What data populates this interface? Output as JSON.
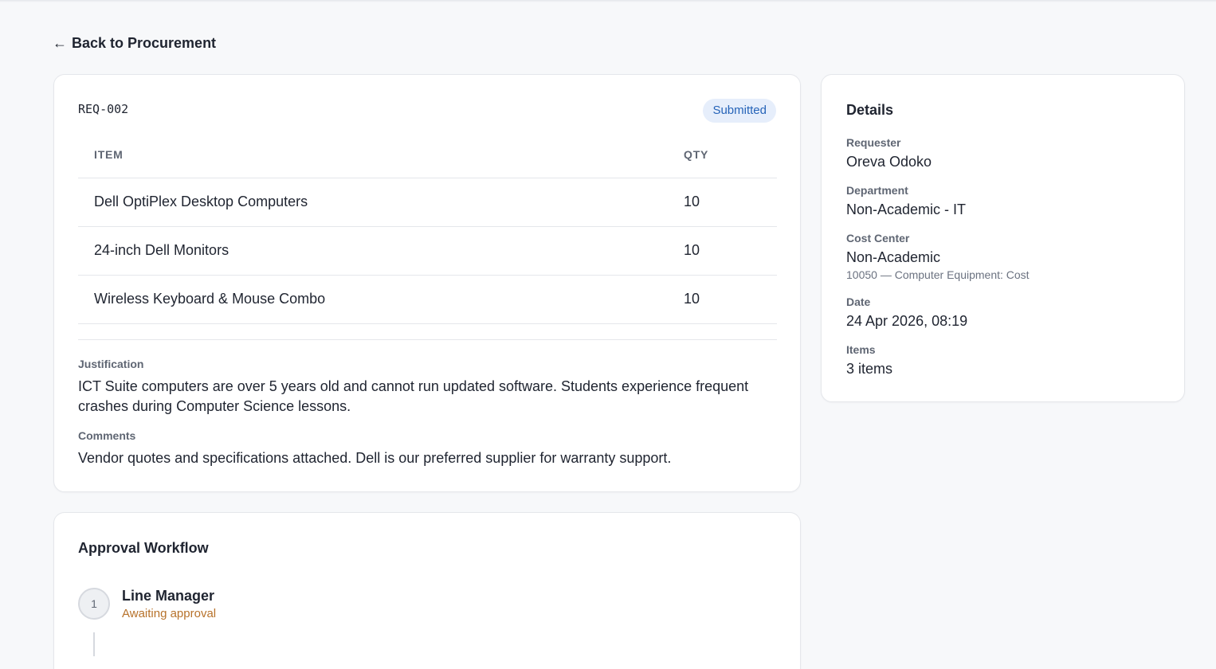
{
  "nav": {
    "back_arrow": "←",
    "back_label": "Back to Procurement"
  },
  "request": {
    "id": "REQ-002",
    "status": "Submitted",
    "table": {
      "headers": [
        "ITEM",
        "QTY"
      ],
      "rows": [
        {
          "item": "Dell OptiPlex Desktop Computers",
          "qty": "10"
        },
        {
          "item": "24-inch Dell Monitors",
          "qty": "10"
        },
        {
          "item": "Wireless Keyboard & Mouse Combo",
          "qty": "10"
        }
      ]
    },
    "justification_label": "Justification",
    "justification": "ICT Suite computers are over 5 years old and cannot run updated software. Students experience frequent crashes during Computer Science lessons.",
    "comments_label": "Comments",
    "comments": "Vendor quotes and specifications attached. Dell is our preferred supplier for warranty support."
  },
  "workflow": {
    "title": "Approval Workflow",
    "steps": [
      {
        "number": "1",
        "title": "Line Manager",
        "status": "Awaiting approval"
      }
    ]
  },
  "details": {
    "title": "Details",
    "requester_label": "Requester",
    "requester": "Oreva Odoko",
    "department_label": "Department",
    "department": "Non-Academic - IT",
    "cost_center_label": "Cost Center",
    "cost_center": "Non-Academic",
    "cost_center_code": "10050 — Computer Equipment: Cost",
    "date_label": "Date",
    "date": "24 Apr 2026, 08:19",
    "items_label": "Items",
    "items": "3 items"
  },
  "colors": {
    "status_badge_bg": "#e6eefb",
    "status_badge_text": "#2563b8",
    "awaiting_text": "#b7722b"
  }
}
